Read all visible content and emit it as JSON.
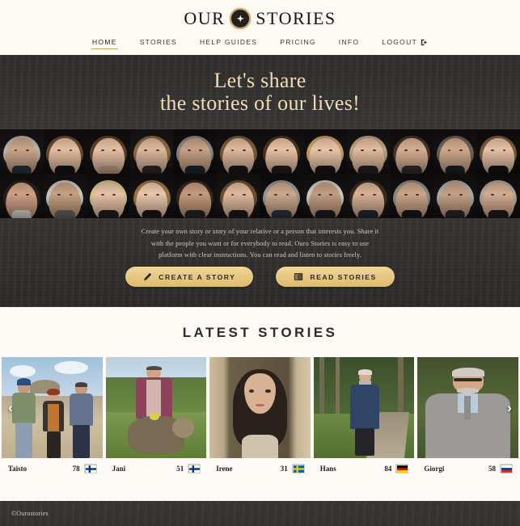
{
  "brand": {
    "word_left": "OUR",
    "word_right": "STORIES",
    "badge_icon": "star-badge-icon"
  },
  "nav": {
    "items": [
      {
        "label": "HOME",
        "active": true
      },
      {
        "label": "STORIES",
        "active": false
      },
      {
        "label": "HELP GUIDES",
        "active": false
      },
      {
        "label": "PRICING",
        "active": false
      },
      {
        "label": "INFO",
        "active": false
      }
    ],
    "logout_label": "LOGOUT"
  },
  "hero": {
    "title_line1": "Let's share",
    "title_line2": "the stories of our lives!",
    "paragraph": "Create your own story or story of your relative or a person that interests you. Share it with the people you want or for everybody to read. Ouro Stories is easy to use platform with clear instructions. You can read and listen to stories freely.",
    "primary_button": "CREATE A STORY",
    "secondary_button": "READ STORIES",
    "primary_icon": "pencil-icon",
    "secondary_icon": "book-icon"
  },
  "latest": {
    "title": "LATEST STORIES",
    "prev_label": "‹",
    "next_label": "›",
    "cards": [
      {
        "name": "Taisto",
        "age": "78",
        "country": "Finland",
        "flag": "fi",
        "photo": "three-people-at-sand-quarry"
      },
      {
        "name": "Jani",
        "age": "51",
        "country": "Finland",
        "flag": "fi",
        "photo": "man-with-curly-dog"
      },
      {
        "name": "Irene",
        "age": "31",
        "country": "Sweden",
        "flag": "se",
        "photo": "young-woman-portrait-doorway"
      },
      {
        "name": "Hans",
        "age": "84",
        "country": "Germany",
        "flag": "de",
        "photo": "elderly-man-forest-path"
      },
      {
        "name": "Giorgi",
        "age": "58",
        "country": "Russia",
        "flag": "ru",
        "photo": "man-glasses-grey-sweater"
      }
    ]
  },
  "footer": {
    "copyright": "©Ourostories"
  },
  "colors": {
    "gold": "#c6a160",
    "hero_bg": "#353331",
    "cream": "#fdfaf5",
    "button_gold": "#e6c680",
    "heading_cream": "#f0ddb6"
  }
}
